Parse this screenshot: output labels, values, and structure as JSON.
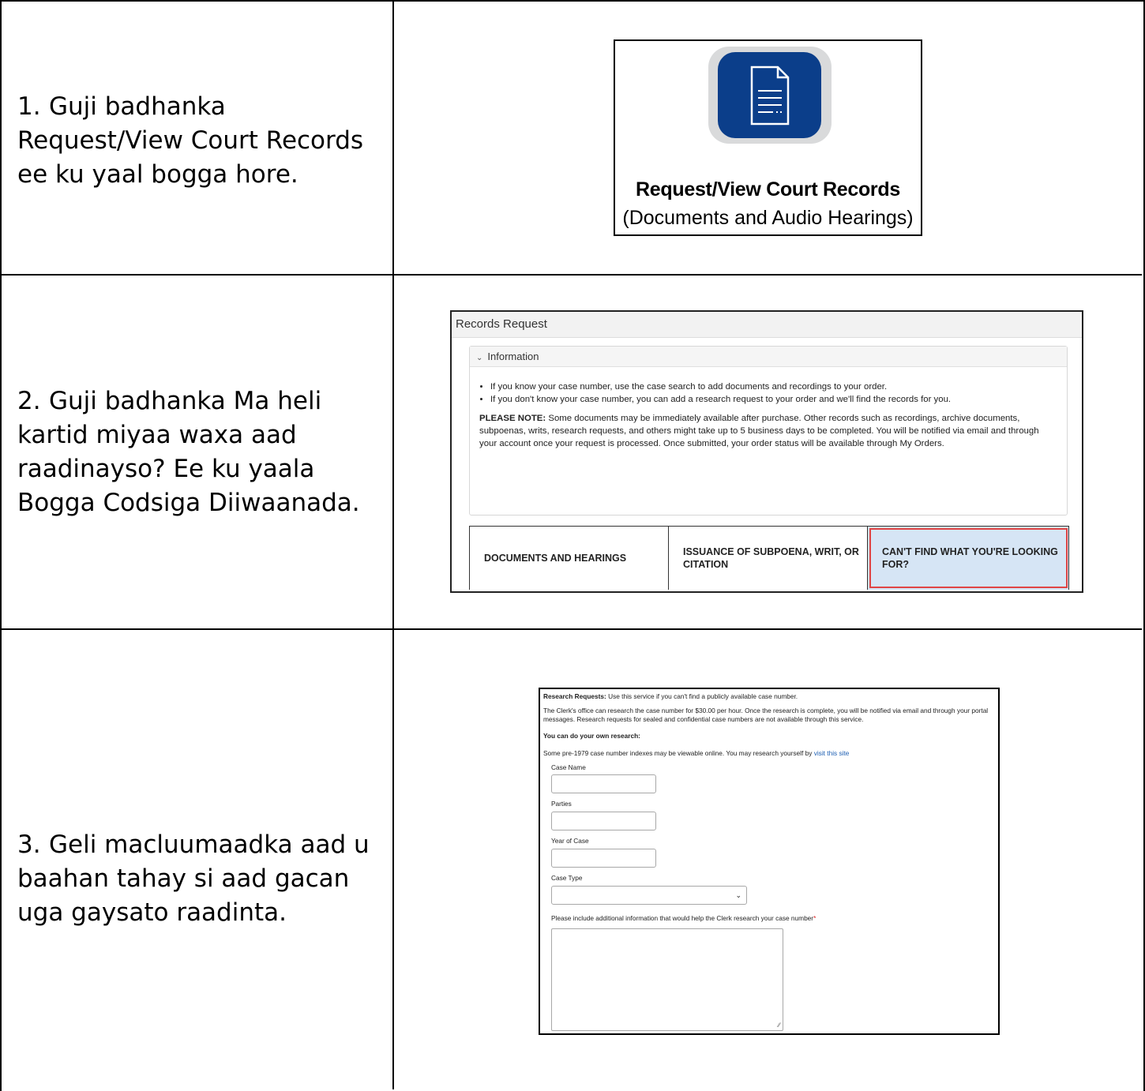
{
  "steps": [
    {
      "num": "1.",
      "text": "Guji badhanka Request/View Court Records ee ku yaal bogga hore."
    },
    {
      "num": "2.",
      "text": "Guji badhanka Ma heli kartid miyaa waxa aad raadinayso? Ee ku yaala Bogga Codsiga Diiwaanada."
    },
    {
      "num": "3.",
      "text": "Geli macluumaadka aad u baahan tahay si aad gacan uga gaysato raadinta."
    }
  ],
  "tile": {
    "title": "Request/View Court Records",
    "subtitle": "(Documents and Audio Hearings)",
    "icon": "document-icon",
    "colors": {
      "icon_bg": "#0b3e8a",
      "icon_frame": "#d9dadb"
    }
  },
  "records_request": {
    "header": "Records Request",
    "section": "Information",
    "bullets": [
      "If you know your case number, use the case search to add documents and recordings to your order.",
      "If you don't know your case number, you can add a research request to your order and we'll find the records for you."
    ],
    "note_label": "PLEASE NOTE:",
    "note_text": "Some documents may be immediately available after purchase. Other records such as recordings, archive documents, subpoenas, writs, research requests, and others might take up to 5 business days to be completed. You will be notified via email and through your account once your request is processed. Once submitted, your order status will be available through My Orders.",
    "tabs": [
      "DOCUMENTS AND HEARINGS",
      "ISSUANCE OF SUBPOENA, WRIT, OR CITATION",
      "CAN'T FIND WHAT YOU'RE LOOKING FOR?"
    ],
    "selected_tab": 2,
    "colors": {
      "selected_bg": "#d6e5f5",
      "highlight": "#e04545"
    }
  },
  "research": {
    "intro_label": "Research Requests:",
    "intro_text": "Use this service if you can't find a publicly available case number.",
    "paragraph": "The Clerk's office can research the case number for $30.00 per hour. Once the research is complete, you will be notified via email and through your portal messages. Research requests for sealed and confidential case numbers are not available through this service.",
    "own_heading": "You can do your own research:",
    "own_text": "Some pre-1979 case number indexes may be viewable online. You may research yourself by",
    "own_link": "visit this site",
    "fields": {
      "case_name": "Case Name",
      "parties": "Parties",
      "year": "Year of Case",
      "type": "Case Type",
      "info": "Please include additional information that would help the Clerk research your case number"
    },
    "required_mark": "*"
  }
}
